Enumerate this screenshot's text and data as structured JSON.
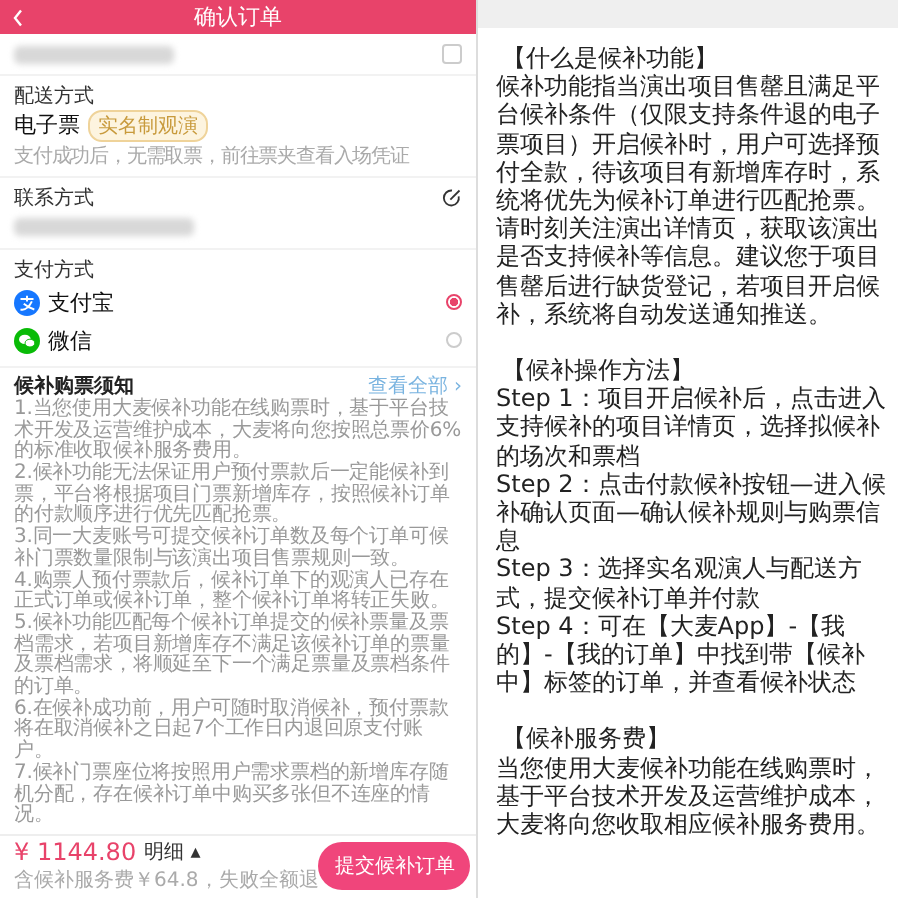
{
  "order_screen": {
    "title": "确认订单",
    "viewer": {
      "checked": false
    },
    "delivery": {
      "label": "配送方式",
      "method": "电子票",
      "tag": "实名制观演",
      "note": "支付成功后，无需取票，前往票夹查看入场凭证"
    },
    "contact": {
      "label": "联系方式"
    },
    "payment": {
      "label": "支付方式",
      "options": [
        {
          "name": "支付宝",
          "kind": "alipay",
          "selected": true
        },
        {
          "name": "微信",
          "kind": "wechat",
          "selected": false
        }
      ]
    },
    "notice": {
      "title": "候补购票须知",
      "link": "查看全部 ›",
      "items": [
        "1.当您使用大麦候补功能在线购票时，基于平台技术开发及运营维护成本，大麦将向您按照总票价6%的标准收取候补服务费用。",
        "2.候补功能无法保证用户预付票款后一定能候补到票，平台将根据项目门票新增库存，按照候补订单的付款顺序进行优先匹配抢票。",
        "3.同一大麦账号可提交候补订单数及每个订单可候补门票数量限制与该演出项目售票规则一致。",
        "4.购票人预付票款后，候补订单下的观演人已存在正式订单或候补订单，整个候补订单将转正失败。",
        "5.候补功能匹配每个候补订单提交的候补票量及票档需求，若项目新增库存不满足该候补订单的票量及票档需求，将顺延至下一个满足票量及票档条件的订单。",
        "6.在候补成功前，用户可随时取消候补，预付票款将在取消候补之日起7个工作日内退回原支付账户。",
        "7.候补门票座位将按照用户需求票档的新增库存随机分配，存在候补订单中购买多张但不连座的情况。"
      ]
    },
    "footer": {
      "price": "¥ 1144.80",
      "details": "明细 ▴",
      "fee_note": "含候补服务费￥64.8，失败全额退",
      "submit": "提交候补订单"
    }
  },
  "info_screen": {
    "paragraphs": [
      {
        "kind": "heading",
        "text": "【什么是候补功能】"
      },
      {
        "kind": "text",
        "text": "候补功能指当演出项目售罄且满足平台候补条件（仅限支持条件退的电子票项目）开启候补时，用户可选择预付全款，待该项目有新增库存时，系统将优先为候补订单进行匹配抢票。"
      },
      {
        "kind": "text",
        "text": "请时刻关注演出详情页，获取该演出是否支持候补等信息。建议您于项目售罄后进行缺货登记，若项目开启候补，系统将自动发送通知推送。"
      },
      {
        "kind": "heading",
        "text": "【候补操作方法】"
      },
      {
        "kind": "text",
        "text": "Step 1：项目开启候补后，点击进入支持候补的项目详情页，选择拟候补的场次和票档"
      },
      {
        "kind": "text",
        "text": "Step 2：点击付款候补按钮—进入候补确认页面—确认候补规则与购票信息"
      },
      {
        "kind": "text",
        "text": "Step 3：选择实名观演人与配送方式，提交候补订单并付款"
      },
      {
        "kind": "text",
        "text": "Step 4：可在【大麦App】-【我的】-【我的订单】中找到带【候补中】标签的订单，并查看候补状态"
      },
      {
        "kind": "heading",
        "text": "【候补服务费】"
      },
      {
        "kind": "text",
        "text": "当您使用大麦候补功能在线购票时，基于平台技术开发及运营维护成本，大麦将向您收取相应候补服务费用。"
      }
    ]
  }
}
